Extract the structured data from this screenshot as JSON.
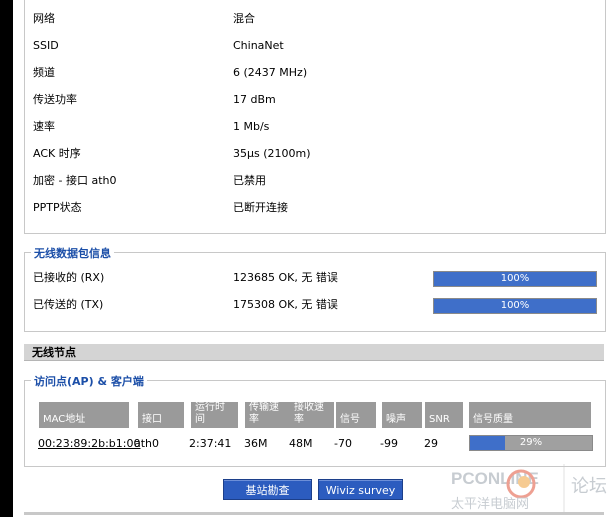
{
  "wireless_info": [
    {
      "label": "网络",
      "value": "混合"
    },
    {
      "label": "SSID",
      "value": "ChinaNet"
    },
    {
      "label": "频道",
      "value": "6 (2437 MHz)"
    },
    {
      "label": "传送功率",
      "value": "17 dBm"
    },
    {
      "label": "速率",
      "value": "1 Mb/s"
    },
    {
      "label": "ACK 时序",
      "value": "35µs (2100m)"
    },
    {
      "label": "加密 - 接口 ath0",
      "value": "已禁用"
    },
    {
      "label": "PPTP状态",
      "value": "已断开连接"
    }
  ],
  "packet_info": {
    "legend": "无线数据包信息",
    "rows": [
      {
        "label": "已接收的 (RX)",
        "value": "123685 OK, 无  错误",
        "bar_label": "100%",
        "bar_fraction": 1.0
      },
      {
        "label": "已传送的 (TX)",
        "value": "175308 OK, 无  错误",
        "bar_label": "100%",
        "bar_fraction": 1.0
      }
    ]
  },
  "nodes_section": {
    "title": "无线节点"
  },
  "ap_clients": {
    "legend": "访问点(AP) & 客户端",
    "headers": [
      "MAC地址",
      "接口",
      "运行时间",
      "传输速率",
      "接收速率",
      "信号",
      "噪声",
      "SNR",
      "信号质量"
    ],
    "rows": [
      {
        "mac": "00:23:89:2b:b1:00",
        "interface": "ath0",
        "uptime": "2:37:41",
        "tx_rate": "36M",
        "rx_rate": "48M",
        "signal": "-70",
        "noise": "-99",
        "snr": "29",
        "quality_label": "29%",
        "quality_fraction": 0.29
      }
    ]
  },
  "buttons": {
    "site_survey": "基站勘查",
    "wiviz": "Wiviz survey"
  },
  "watermark": {
    "brand": "PCONLINE",
    "sub": "太平洋电脑网",
    "forum": "论坛"
  },
  "colors": {
    "accent": "#3f6fc9",
    "legend": "#1c4fa8",
    "header_bg": "#9a9a9a"
  }
}
